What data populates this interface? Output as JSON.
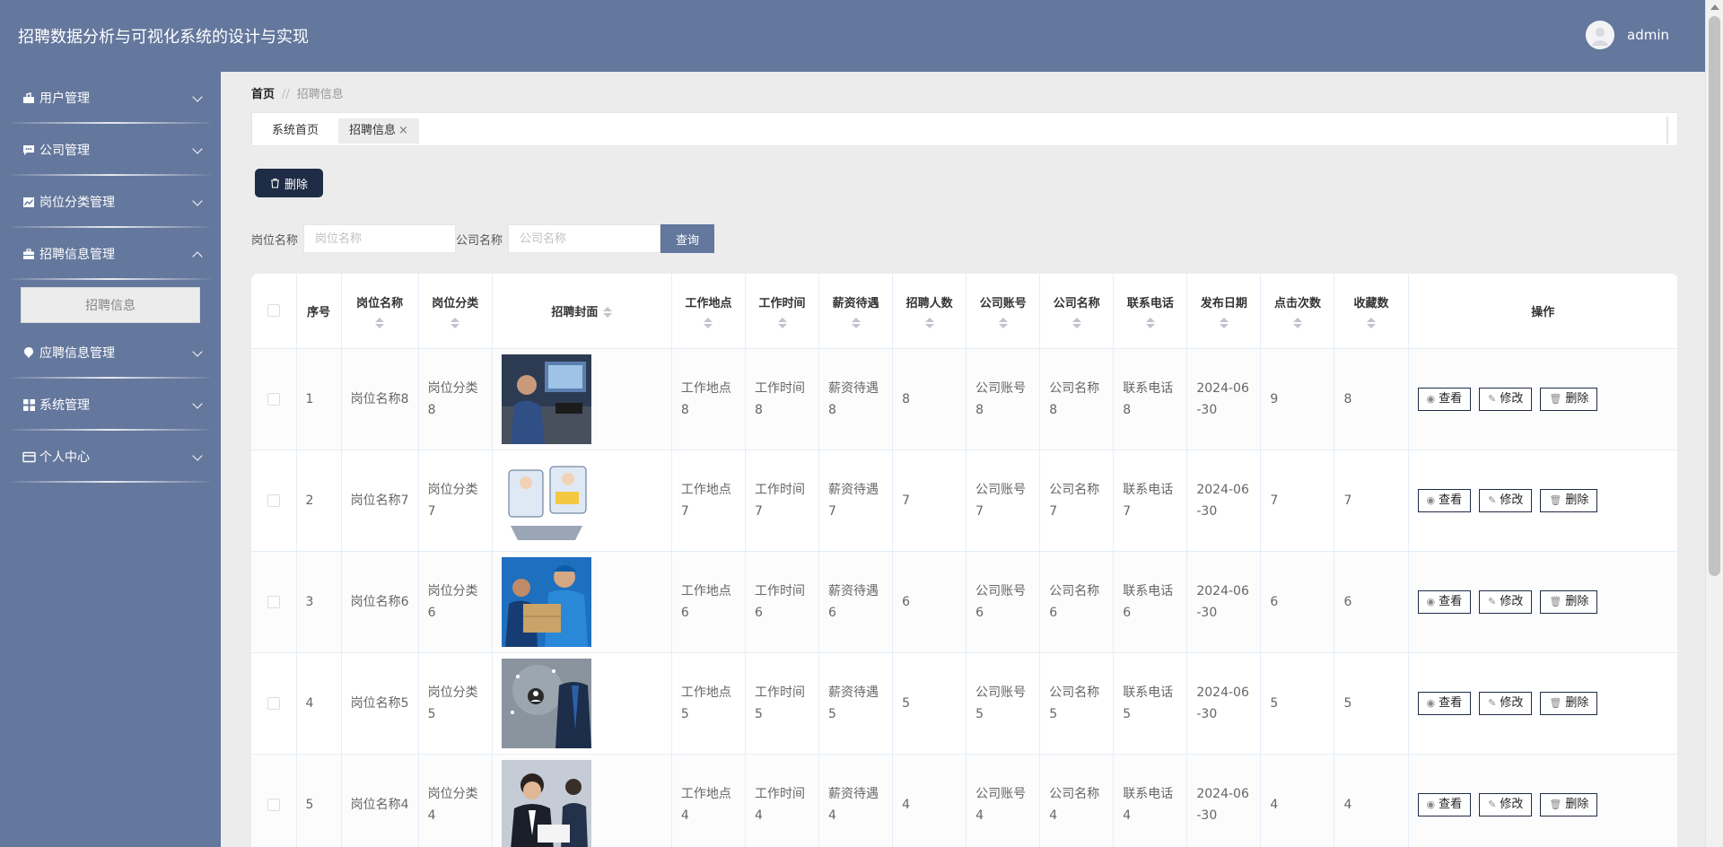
{
  "header": {
    "title": "招聘数据分析与可视化系统的设计与实现",
    "username": "admin"
  },
  "sidebar": {
    "items": [
      {
        "label": "用户管理",
        "icon": "briefcase-icon",
        "expanded": false
      },
      {
        "label": "公司管理",
        "icon": "chat-icon",
        "expanded": false
      },
      {
        "label": "岗位分类管理",
        "icon": "chart-icon",
        "expanded": false
      },
      {
        "label": "招聘信息管理",
        "icon": "toolbox-icon",
        "expanded": true,
        "children": [
          "招聘信息"
        ]
      },
      {
        "label": "应聘信息管理",
        "icon": "pin-icon",
        "expanded": false
      },
      {
        "label": "系统管理",
        "icon": "grid-icon",
        "expanded": false
      },
      {
        "label": "个人中心",
        "icon": "card-icon",
        "expanded": false
      }
    ]
  },
  "breadcrumb": {
    "home": "首页",
    "separator": "//",
    "current": "招聘信息"
  },
  "tabs": [
    {
      "label": "系统首页"
    },
    {
      "label": "招聘信息",
      "close": "×"
    }
  ],
  "toolbar": {
    "delete_label": "删除"
  },
  "search": {
    "job_label": "岗位名称",
    "job_placeholder": "岗位名称",
    "company_label": "公司名称",
    "company_placeholder": "公司名称",
    "query_label": "查询"
  },
  "table": {
    "headers": [
      "序号",
      "岗位名称",
      "岗位分类",
      "招聘封面",
      "工作地点",
      "工作时间",
      "薪资待遇",
      "招聘人数",
      "公司账号",
      "公司名称",
      "联系电话",
      "发布日期",
      "点击次数",
      "收藏数",
      "操作"
    ],
    "actions": {
      "view": "查看",
      "edit": "修改",
      "delete": "删除"
    },
    "rows": [
      {
        "no": "1",
        "job": "岗位名称8",
        "category": "岗位分类\n8",
        "location": "工作地点\n8",
        "worktime": "工作时间\n8",
        "salary": "薪资待遇\n8",
        "count": "8",
        "account": "公司账号\n8",
        "company": "公司名称\n8",
        "phone": "联系电话\n8",
        "date": "2024-06\n-30",
        "clicks": "9",
        "favorites": "8",
        "cover": "office-photo"
      },
      {
        "no": "2",
        "job": "岗位名称7",
        "category": "岗位分类\n7",
        "location": "工作地点\n7",
        "worktime": "工作时间\n7",
        "salary": "薪资待遇\n7",
        "count": "7",
        "account": "公司账号\n7",
        "company": "公司名称\n7",
        "phone": "联系电话\n7",
        "date": "2024-06\n-30",
        "clicks": "7",
        "favorites": "7",
        "cover": "cartoon-illustration"
      },
      {
        "no": "3",
        "job": "岗位名称6",
        "category": "岗位分类\n6",
        "location": "工作地点\n6",
        "worktime": "工作时间\n6",
        "salary": "薪资待遇\n6",
        "count": "6",
        "account": "公司账号\n6",
        "company": "公司名称\n6",
        "phone": "联系电话\n6",
        "date": "2024-06\n-30",
        "clicks": "6",
        "favorites": "6",
        "cover": "delivery-photo"
      },
      {
        "no": "4",
        "job": "岗位名称5",
        "category": "岗位分类\n5",
        "location": "工作地点\n5",
        "worktime": "工作时间\n5",
        "salary": "薪资待遇\n5",
        "count": "5",
        "account": "公司账号\n5",
        "company": "公司名称\n5",
        "phone": "联系电话\n5",
        "date": "2024-06\n-30",
        "clicks": "5",
        "favorites": "5",
        "cover": "business-photo"
      },
      {
        "no": "5",
        "job": "岗位名称4",
        "category": "岗位分类\n4",
        "location": "工作地点\n4",
        "worktime": "工作时间\n4",
        "salary": "薪资待遇\n4",
        "count": "4",
        "account": "公司账号\n4",
        "company": "公司名称\n4",
        "phone": "联系电话\n4",
        "date": "2024-06\n-30",
        "clicks": "4",
        "favorites": "4",
        "cover": "meeting-photo"
      }
    ]
  },
  "colors": {
    "primary": "#64779d",
    "dark": "#1f2c46",
    "background": "#ececec"
  }
}
